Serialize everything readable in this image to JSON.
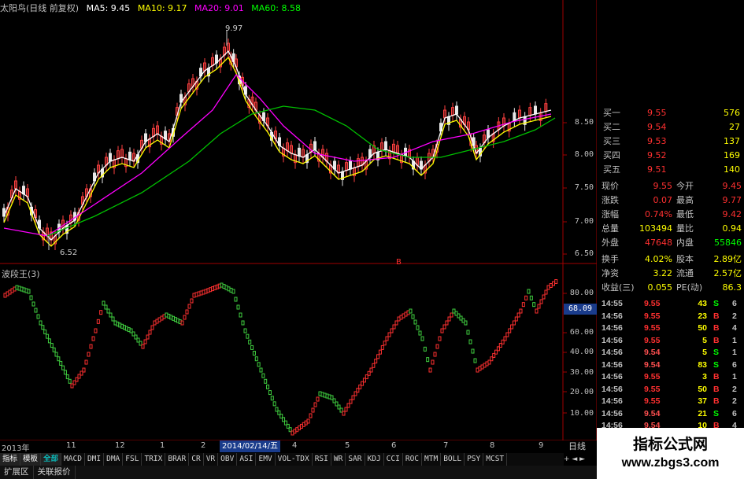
{
  "header": {
    "stock": "太阳鸟(日线 前复权)",
    "ma5": "MA5: 9.45",
    "ma10": "MA10: 9.17",
    "ma20": "MA20: 9.01",
    "ma60": "MA60: 8.58",
    "colors": {
      "ma5": "#ffffff",
      "ma10": "#ffff00",
      "ma20": "#ff00ff",
      "ma60": "#00ff00"
    }
  },
  "main_chart": {
    "high_marker": "9.97",
    "low_marker": "6.52",
    "price_axis": [
      "8.50",
      "8.00",
      "7.50",
      "7.00",
      "6.50"
    ]
  },
  "indicator": {
    "name": "波段王(3)",
    "current": "68.09",
    "marker": "B",
    "axis": [
      "80.00",
      "60.00",
      "40.00",
      "30.00",
      "20.00",
      "10.00"
    ]
  },
  "dates": {
    "labels": [
      "2013年",
      "11",
      "12",
      "1",
      "2",
      "3",
      "4",
      "5",
      "6",
      "7",
      "8",
      "9"
    ],
    "highlight": "2014/02/14/五"
  },
  "tabs": {
    "category": [
      "指标",
      "模板",
      "全部"
    ],
    "items": [
      "MACD",
      "DMI",
      "DMA",
      "FSL",
      "TRIX",
      "BRAR",
      "CR",
      "VR",
      "OBV",
      "ASI",
      "EMV",
      "VOL-TDX",
      "RSI",
      "WR",
      "SAR",
      "KDJ",
      "CCI",
      "ROC",
      "MTM",
      "BOLL",
      "PSY",
      "MCST"
    ],
    "nav": "+ ◄ ►"
  },
  "bottom_tabs": [
    "扩展区",
    "关联报价"
  ],
  "kline_label": "日线",
  "quotes": {
    "bids": [
      {
        "label": "买一",
        "price": "9.55",
        "vol": "576"
      },
      {
        "label": "买二",
        "price": "9.54",
        "vol": "27"
      },
      {
        "label": "买三",
        "price": "9.53",
        "vol": "137"
      },
      {
        "label": "买四",
        "price": "9.52",
        "vol": "169"
      },
      {
        "label": "买五",
        "price": "9.51",
        "vol": "140"
      }
    ],
    "stats": [
      {
        "l1": "现价",
        "v1": "9.55",
        "l2": "今开",
        "v2": "9.45",
        "c1": "#ff3030",
        "c2": "#ff3030"
      },
      {
        "l1": "涨跌",
        "v1": "0.07",
        "l2": "最高",
        "v2": "9.77",
        "c1": "#ff3030",
        "c2": "#ff3030"
      },
      {
        "l1": "涨幅",
        "v1": "0.74%",
        "l2": "最低",
        "v2": "9.42",
        "c1": "#ff3030",
        "c2": "#ff3030"
      },
      {
        "l1": "总量",
        "v1": "103494",
        "l2": "量比",
        "v2": "0.94",
        "c1": "#ffff00",
        "c2": "#ffff00"
      },
      {
        "l1": "外盘",
        "v1": "47648",
        "l2": "内盘",
        "v2": "55846",
        "c1": "#ff3030",
        "c2": "#00ff00"
      }
    ],
    "fund": [
      {
        "l1": "换手",
        "v1": "4.02%",
        "l2": "股本",
        "v2": "2.89亿"
      },
      {
        "l1": "净资",
        "v1": "3.22",
        "l2": "流通",
        "v2": "2.57亿"
      },
      {
        "l1": "收益(三)",
        "v1": "0.055",
        "l2": "PE(动)",
        "v2": "86.3"
      }
    ],
    "ticks": [
      {
        "t": "14:55",
        "p": "9.55",
        "v": "43",
        "s": "S",
        "n": "6"
      },
      {
        "t": "14:56",
        "p": "9.55",
        "v": "23",
        "s": "B",
        "n": "2"
      },
      {
        "t": "14:56",
        "p": "9.55",
        "v": "50",
        "s": "B",
        "n": "4"
      },
      {
        "t": "14:56",
        "p": "9.55",
        "v": "5",
        "s": "B",
        "n": "1"
      },
      {
        "t": "14:56",
        "p": "9.54",
        "v": "5",
        "s": "S",
        "n": "1"
      },
      {
        "t": "14:56",
        "p": "9.54",
        "v": "83",
        "s": "S",
        "n": "6"
      },
      {
        "t": "14:56",
        "p": "9.55",
        "v": "3",
        "s": "B",
        "n": "1"
      },
      {
        "t": "14:56",
        "p": "9.55",
        "v": "50",
        "s": "B",
        "n": "2"
      },
      {
        "t": "14:56",
        "p": "9.55",
        "v": "37",
        "s": "B",
        "n": "2"
      },
      {
        "t": "14:56",
        "p": "9.54",
        "v": "21",
        "s": "S",
        "n": "6"
      },
      {
        "t": "14:56",
        "p": "9.54",
        "v": "10",
        "s": "B",
        "n": "4"
      },
      {
        "t": "14:56",
        "p": "9.54",
        "v": "",
        "s": "",
        "n": ""
      }
    ]
  },
  "watermark": {
    "title": "指标公式网",
    "url": "www.zbgs3.com"
  }
}
